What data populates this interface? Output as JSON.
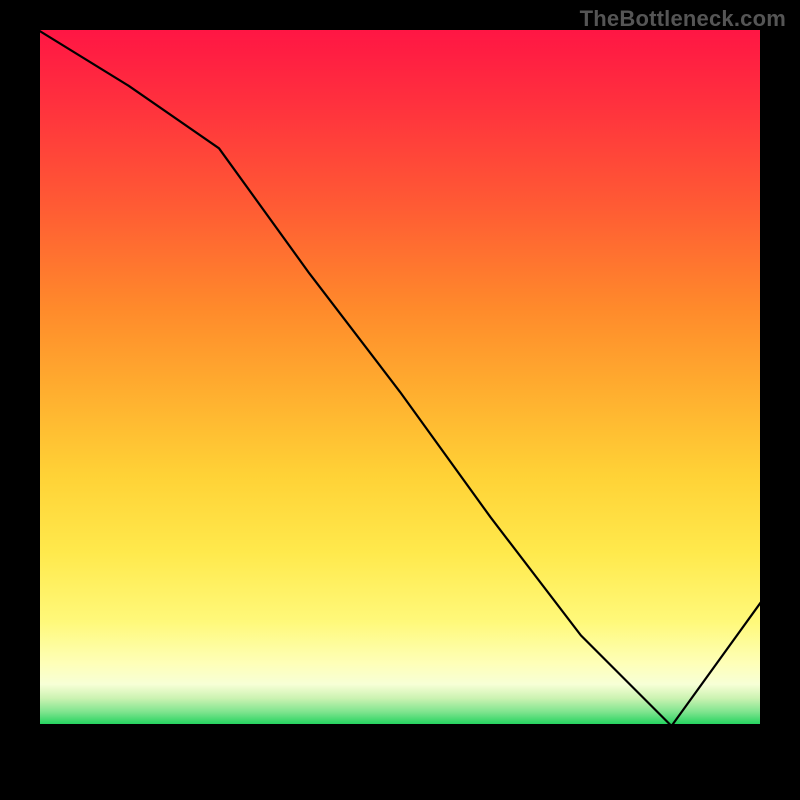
{
  "watermark": "TheBottleneck.com",
  "chart_data": {
    "type": "line",
    "title": "",
    "xlabel": "",
    "ylabel": "",
    "xlim": [
      0,
      8
    ],
    "ylim": [
      0,
      100
    ],
    "x": [
      0,
      1,
      2,
      3,
      4,
      5,
      6,
      7,
      8
    ],
    "values": [
      100,
      92,
      83,
      65,
      48,
      30,
      13,
      0,
      18
    ],
    "bands": [
      {
        "color_top": "#ff1644",
        "color_bottom": "#ff3b3a",
        "start": 100,
        "end": 82
      },
      {
        "color_top": "#ff3b3a",
        "color_bottom": "#ffa526",
        "start": 82,
        "end": 48
      },
      {
        "color_top": "#ffa526",
        "color_bottom": "#ffe43a",
        "start": 48,
        "end": 28
      },
      {
        "color_top": "#ffe43a",
        "color_bottom": "#feff82",
        "start": 28,
        "end": 12
      },
      {
        "color_top": "#feff82",
        "color_bottom": "#fdffc9",
        "start": 12,
        "end": 4
      },
      {
        "color_top": "#c8f7a5",
        "color_bottom": "#2bdc60",
        "start": 4,
        "end": 0
      }
    ],
    "optimal_label": "",
    "optimal_marker_x_range": [
      5.8,
      7.2
    ]
  },
  "colors": {
    "background": "#000000",
    "line": "#000000",
    "axis": "#000000",
    "marker_text": "#ff4a2e"
  }
}
